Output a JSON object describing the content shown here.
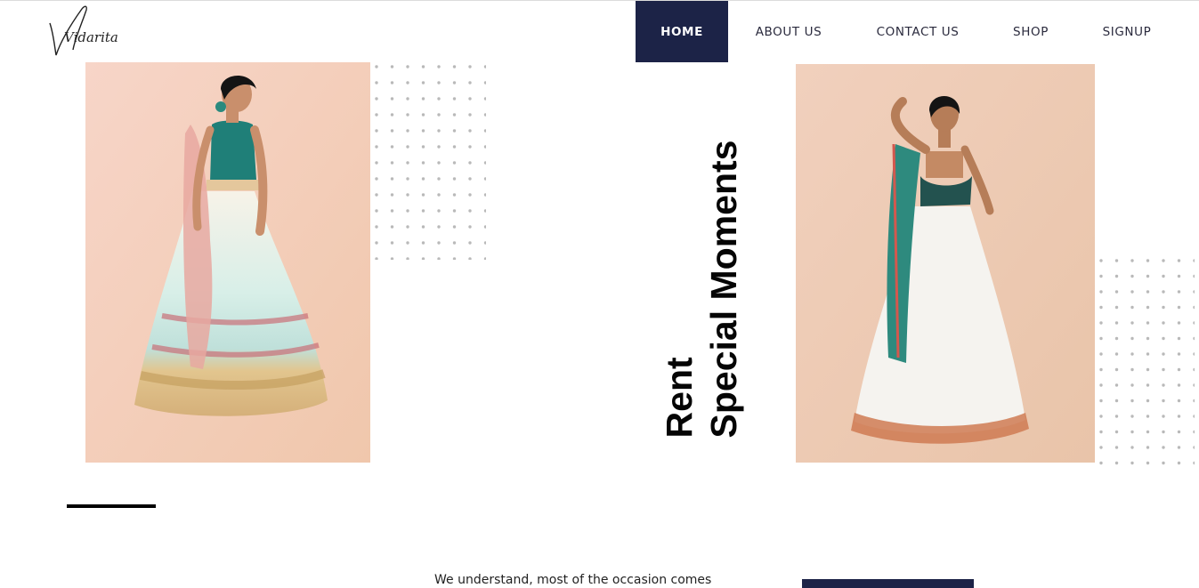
{
  "brand": {
    "logo_text": "Vidarita"
  },
  "nav": {
    "items": [
      {
        "label": "HOME",
        "active": true
      },
      {
        "label": "ABOUT US",
        "active": false
      },
      {
        "label": "CONTACT US",
        "active": false
      },
      {
        "label": "SHOP",
        "active": false
      },
      {
        "label": "SIGNUP",
        "active": false
      }
    ]
  },
  "hero": {
    "vertical_heading": "Rent\nSpecial Moments"
  },
  "intro": {
    "text": "We understand, most of the occasion comes"
  },
  "colors": {
    "accent": "#1c2347",
    "photo_bg": "#f3cdb8",
    "dots": "#b9b9b9"
  }
}
